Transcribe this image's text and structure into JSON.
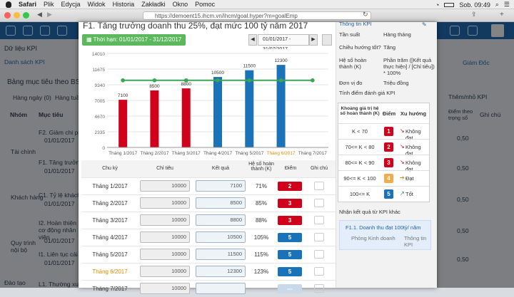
{
  "menubar": {
    "apple": "",
    "app": "Safari",
    "items": [
      "Plik",
      "Edycja",
      "Widok",
      "Historia",
      "Zakładki",
      "Okno",
      "Pomoc"
    ],
    "status": "Sob. 09:49"
  },
  "browser": {
    "url": "https://demoent15.ihcm.vn/ihcm/goal.hyper?m=goalEmp"
  },
  "background": {
    "section": "Dữ liệu KPI",
    "list_btn": "Danh sách KPI",
    "board_title": "Bảng mục tiêu theo BSC",
    "filter": "Hàng ngày (0)",
    "filter2": "Hàng tuần",
    "col_group": "Nhóm",
    "col_goal": "Mục tiêu",
    "manager": "Giám Đốc",
    "add_kpi": "Thêm/nhỏ KPI",
    "col_point": "Điểm theo trọng số",
    "col_note": "Ghi chú",
    "groups": [
      "Tài chính",
      "Khách hàng",
      "Quy trình nội bộ",
      "Đào tạo"
    ],
    "goals": [
      {
        "name": "F2. Giảm chi phí",
        "date": "01/01/2017"
      },
      {
        "name": "F1. Tăng trưởng",
        "date": "01/01/2017"
      },
      {
        "name": "C1. Tỷ lệ khách",
        "date": "01/01/2017"
      },
      {
        "name": "I2. Hoàn thiện cơ động nhân viên",
        "date": "01/01/2017"
      },
      {
        "name": "I1. Liên tục cải t",
        "date": "01/01/2017"
      },
      {
        "name": "L1. Thường xuyê",
        "date": ""
      }
    ],
    "scores": [
      "0,50",
      "0,50",
      "0,50",
      "0,50",
      "0,50"
    ]
  },
  "modal": {
    "title": "F1. Tăng trưởng doanh thu 25%, đạt mức 100 tỷ năm 2017",
    "period_label": "Thời hạn:",
    "period": "01/01/2017 - 31/12/2017",
    "range": "01/01/2017 - 31/07/2017",
    "prev": "◀",
    "next": "▶"
  },
  "chart_data": {
    "type": "bar",
    "categories": [
      "Tháng 1/2017",
      "Tháng 2/2017",
      "Tháng 3/2017",
      "Tháng 4/2017",
      "Tháng 5/2017",
      "Tháng 6/2017",
      "Tháng 7/2017"
    ],
    "values": [
      7100,
      8500,
      8800,
      10500,
      11500,
      12300,
      null
    ],
    "target": [
      10000,
      10000,
      10000,
      10000,
      10000,
      10000,
      10000
    ],
    "bar_colors": [
      "#d0021b",
      "#d0021b",
      "#d0021b",
      "#1a73b8",
      "#1a73b8",
      "#1a73b8",
      "#1a73b8"
    ],
    "target_color": "#3aa655",
    "highlight_category": "Tháng 6/2017",
    "yticks": [
      "0",
      "2335",
      "4670",
      "7005",
      "9340",
      "11675",
      "14010"
    ],
    "ylim": [
      0,
      14010
    ]
  },
  "table": {
    "headers": [
      "Chu kỳ",
      "Chỉ tiêu",
      "Kết quả",
      "Hệ số hoàn thành (K)",
      "Điểm",
      "Ghi chú"
    ],
    "rows": [
      {
        "period": "Tháng 1/2017",
        "target": "10000",
        "result": "7100",
        "k": "71%",
        "score": "2",
        "color": "#d0021b"
      },
      {
        "period": "Tháng 2/2017",
        "target": "10000",
        "result": "8500",
        "k": "85%",
        "score": "3",
        "color": "#d0021b"
      },
      {
        "period": "Tháng 3/2017",
        "target": "10000",
        "result": "8800",
        "k": "88%",
        "score": "3",
        "color": "#d0021b"
      },
      {
        "period": "Tháng 4/2017",
        "target": "10000",
        "result": "10500",
        "k": "105%",
        "score": "5",
        "color": "#1a73b8"
      },
      {
        "period": "Tháng 5/2017",
        "target": "10000",
        "result": "11500",
        "k": "115%",
        "score": "5",
        "color": "#1a73b8"
      },
      {
        "period": "Tháng 6/2017",
        "target": "10000",
        "result": "12300",
        "k": "123%",
        "score": "5",
        "color": "#1a73b8"
      },
      {
        "period": "Tháng 7/2017",
        "target": "10000",
        "result": "",
        "k": "",
        "score": "---",
        "color": "#c9d9ea"
      }
    ]
  },
  "kpi_info": {
    "header": "Thông tin KPI",
    "fields": [
      {
        "label": "Tần suất",
        "value": "Hàng tháng"
      },
      {
        "label": "Chiều hướng tốt?",
        "value": "Tăng"
      },
      {
        "label": "Hệ số hoàn thành (K)",
        "value": "Phần trăm ([Kết quả thực hiện] / [Chỉ tiêu]) * 100%"
      },
      {
        "label": "Đơn vị đo",
        "value": "Triệu đồng"
      }
    ],
    "scoring_title": "Tính điểm đánh giá KPI",
    "scoring_headers": [
      "Khoảng giá trị hệ số hoàn thành (K)",
      "Điểm",
      "Xu hướng"
    ],
    "scoring": [
      {
        "range": "K < 70",
        "score": "1",
        "trend": "Không đạt",
        "color": "#d0021b",
        "arrow": "↘",
        "acolor": "#d0021b"
      },
      {
        "range": "70<= K < 80",
        "score": "2",
        "trend": "Không đạt",
        "color": "#d0021b",
        "arrow": "↘",
        "acolor": "#d0021b"
      },
      {
        "range": "80<= K < 90",
        "score": "3",
        "trend": "Không đạt",
        "color": "#d0021b",
        "arrow": "↘",
        "acolor": "#d0021b"
      },
      {
        "range": "90<= K < 100",
        "score": "4",
        "trend": "Đạt",
        "color": "#f0ad4e",
        "arrow": "➔",
        "acolor": "#e08a00"
      },
      {
        "range": "100<= K",
        "score": "5",
        "trend": "Tốt",
        "color": "#1a73b8",
        "arrow": "↗",
        "acolor": "#1a73b8"
      }
    ],
    "other_title": "Nhận kết quả từ KPI khác",
    "other_kpi": "F1.1. Doanh thu đạt 100tỷ/ năm",
    "other_dept": "Phòng Kinh doanh",
    "other_info": "Thông tin KPI"
  }
}
